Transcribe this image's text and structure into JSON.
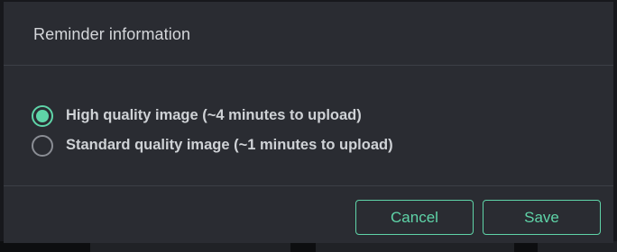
{
  "dialog": {
    "title": "Reminder information"
  },
  "options": [
    {
      "label": "High quality image (~4 minutes to upload)",
      "checked": true
    },
    {
      "label": "Standard quality image (~1 minutes to upload)",
      "checked": false
    }
  ],
  "footer": {
    "cancel_label": "Cancel",
    "save_label": "Save"
  },
  "colors": {
    "accent": "#5fd4a8",
    "dialog_bg": "#2a2c32",
    "text": "#cfd2d6"
  }
}
